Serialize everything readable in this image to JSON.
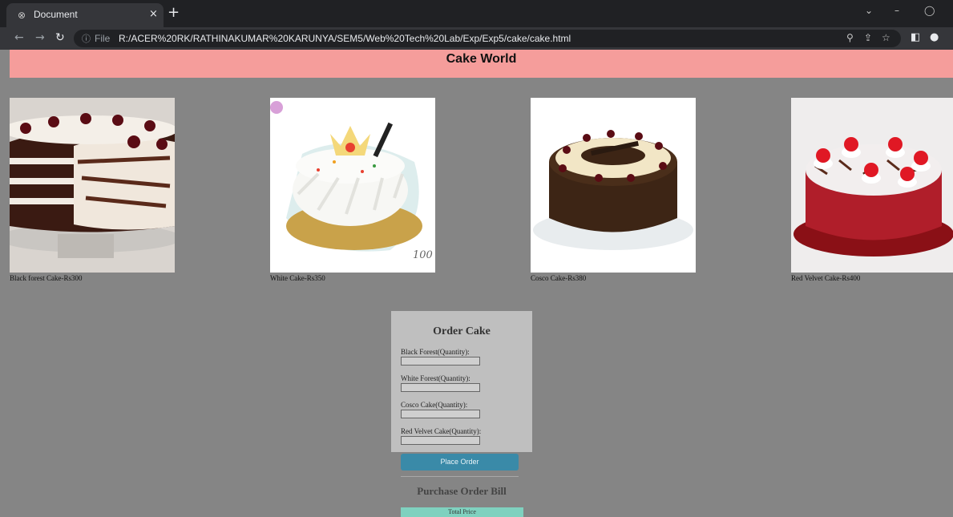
{
  "browser": {
    "tab_title": "Document",
    "tab_close": "×",
    "new_tab": "+",
    "url_scheme": "File",
    "url": "R:/ACER%20RK/RATHINAKUMAR%20KARUNYA/SEM5/Web%20Tech%20Lab/Exp/Exp5/cake/cake.html"
  },
  "page": {
    "title": "Cake World",
    "cakes": [
      {
        "caption": "Black forest Cake-Rs300",
        "icon": "black-forest-cake-image"
      },
      {
        "caption": "White Cake-Rs350",
        "icon": "white-cake-image"
      },
      {
        "caption": "Cosco Cake-Rs380",
        "icon": "cosco-cake-image"
      },
      {
        "caption": "Red Velvet Cake-Rs400",
        "icon": "red-velvet-cake-image"
      }
    ],
    "order": {
      "heading": "Order Cake",
      "fields": [
        {
          "label": "Black Forest(Quantity):",
          "value": ""
        },
        {
          "label": "White Forest(Quantity):",
          "value": ""
        },
        {
          "label": "Cosco Cake(Quantity):",
          "value": ""
        },
        {
          "label": "Red Velvet Cake(Quantity):",
          "value": ""
        }
      ],
      "place_order_label": "Place Order"
    },
    "bill": {
      "heading": "Purchase Order Bill",
      "total_label": "Total Price"
    }
  },
  "colors": {
    "header_bg": "#f59d9b",
    "page_bg": "#858585",
    "order_box_bg": "#bfbfbf",
    "button_bg": "#3a8aa8",
    "total_bg": "#7fd1bf"
  }
}
